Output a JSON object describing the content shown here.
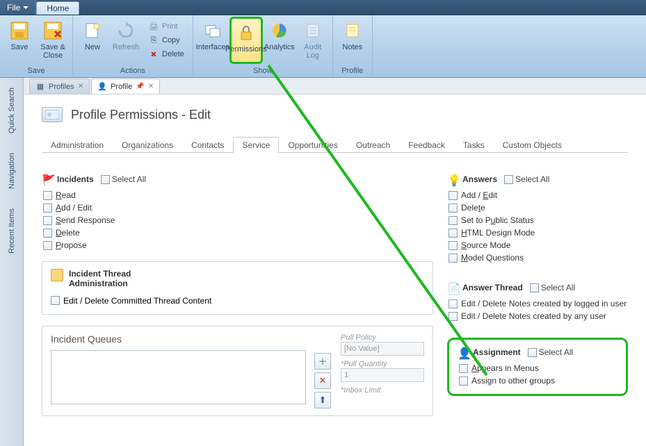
{
  "menubar": {
    "file": "File",
    "home": "Home"
  },
  "ribbon": {
    "groups": {
      "save": {
        "label": "Save",
        "save": "Save",
        "save_close": "Save &\nClose"
      },
      "actions": {
        "label": "Actions",
        "new": "New",
        "refresh": "Refresh",
        "print": "Print",
        "copy": "Copy",
        "delete": "Delete"
      },
      "show": {
        "label": "Show",
        "interfaces": "Interfaces",
        "permissions": "Permissions",
        "analytics": "Analytics",
        "audit": "Audit\nLog"
      },
      "profile": {
        "label": "Profile",
        "notes": "Notes"
      }
    }
  },
  "siderail": {
    "quick_search": "Quick Search",
    "navigation": "Navigation",
    "recent_items": "Recent Items"
  },
  "doctabs": {
    "profiles": "Profiles",
    "profile": "Profile"
  },
  "page": {
    "title": "Profile Permissions - Edit"
  },
  "tabs": [
    "Administration",
    "Organizations",
    "Contacts",
    "Service",
    "Opportunities",
    "Outreach",
    "Feedback",
    "Tasks",
    "Custom Objects"
  ],
  "tabs_active_index": 3,
  "incidents": {
    "title": "Incidents",
    "select_all": "Select All",
    "items": [
      {
        "pre": "",
        "u": "R",
        "post": "ead"
      },
      {
        "pre": "",
        "u": "A",
        "post": "dd / Edit"
      },
      {
        "pre": "",
        "u": "S",
        "post": "end Response"
      },
      {
        "pre": "",
        "u": "D",
        "post": "elete"
      },
      {
        "pre": "",
        "u": "P",
        "post": "ropose"
      }
    ]
  },
  "thread_admin": {
    "title_l1": "Incident Thread",
    "title_l2": "Administration",
    "item": "Edit / Delete Committed Thread Content"
  },
  "queues": {
    "title": "Incident Queues",
    "pull_policy_label": "Pull Policy",
    "pull_policy_value": "[No Value]",
    "pull_qty_label": "Pull Quantity",
    "pull_qty_value": "1",
    "inbox_label": "Inbox Limit"
  },
  "answers": {
    "title": "Answers",
    "select_all": "Select All",
    "items": [
      {
        "pre": "Add / ",
        "u": "E",
        "post": "dit"
      },
      {
        "pre": "Dele",
        "u": "t",
        "post": "e"
      },
      {
        "pre": "Set to P",
        "u": "u",
        "post": "blic Status"
      },
      {
        "pre": "",
        "u": "H",
        "post": "TML Design Mode"
      },
      {
        "pre": "",
        "u": "S",
        "post": "ource Mode"
      },
      {
        "pre": "",
        "u": "M",
        "post": "odel Questions"
      }
    ]
  },
  "answer_thread": {
    "title": "Answer Thread",
    "select_all": "Select All",
    "items": [
      "Edit / Delete Notes created by logged in user",
      "Edit / Delete Notes created by any user"
    ]
  },
  "assignment": {
    "title": "Assignment",
    "select_all": "Select All",
    "items": [
      {
        "pre": "",
        "u": "A",
        "post": "ppears in Menus"
      },
      {
        "pre": "Assi",
        "u": "g",
        "post": "n to other groups"
      }
    ]
  }
}
